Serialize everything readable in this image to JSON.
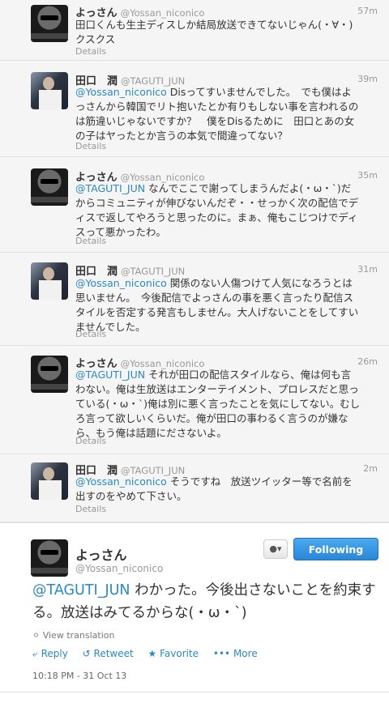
{
  "tweets": [
    {
      "name": "よっさん",
      "handle": "@Yossan_niconico",
      "time": "57m",
      "mention": "",
      "text": "田口くんも生主ディスしか結局放送できてないじゃん(・∀・)クスクス",
      "details": "Details"
    },
    {
      "name": "田口　潤",
      "handle": "@TAGUTI_JUN",
      "time": "39m",
      "mention": "@Yossan_niconico",
      "text": " Disってすいませんでした。　でも僕はよっさんから韓国でリト抱いたとか有りもしない事を言われるのは筋違いじゃないですか？　僕をDisるために　田口とあの女の子はヤったとか言うの本気で間違ってない？",
      "details": "Details"
    },
    {
      "name": "よっさん",
      "handle": "@Yossan_niconico",
      "time": "35m",
      "mention": "@TAGUTI_JUN",
      "text": " なんでここで謝ってしまうんだよ(・ω・`)だからコミュニティが伸びないんだぞ・・せっかく次の配信でディスで返してやろうと思ったのに。まぁ、俺もこじつけでディスって悪かったわ。",
      "details": "Details"
    },
    {
      "name": "田口　潤",
      "handle": "@TAGUTI_JUN",
      "time": "31m",
      "mention": "@Yossan_niconico",
      "text": " 関係のない人傷つけて人気になろうとは思いません。　今後配信でよっさんの事を悪く言ったり配信スタイルを否定する発言もしません。大人げないことをしてすいませんでした。",
      "details": "Details"
    },
    {
      "name": "よっさん",
      "handle": "@Yossan_niconico",
      "time": "26m",
      "mention": "@TAGUTI_JUN",
      "text": " それが田口の配信スタイルなら、俺は何も言わない。俺は生放送はエンターテイメント、プロレスだと思っている(・ω・`)俺は別に悪く言ったことを気にしてない。むしろ言って欲しいくらいだ。俺が田口の事わるく言うのが嫌なら、もう俺は話題にださないよ。",
      "details": "Details"
    },
    {
      "name": "田口　潤",
      "handle": "@TAGUTI_JUN",
      "time": "2m",
      "mention": "@Yossan_niconico",
      "text": " そうですね　放送ツイッター等で名前を出すのをやめて下さい。",
      "details": "Details"
    }
  ],
  "main_tweet": {
    "name": "よっさん",
    "handle": "@Yossan_niconico",
    "user_button": "▾",
    "follow_label": "Following",
    "mention": "@TAGUTI_JUN",
    "text": " わかった。今後出さないことを約束する。放送はみてるからな(・ω・`)",
    "view_translation": "View translation",
    "reply": "Reply",
    "retweet": "Retweet",
    "favorite": "Favorite",
    "more": "More",
    "timestamp": "10:18 PM - 31 Oct 13"
  },
  "colors": {
    "link": "#2a8ac4",
    "follow": "#2b87d7",
    "muted": "#999999"
  }
}
